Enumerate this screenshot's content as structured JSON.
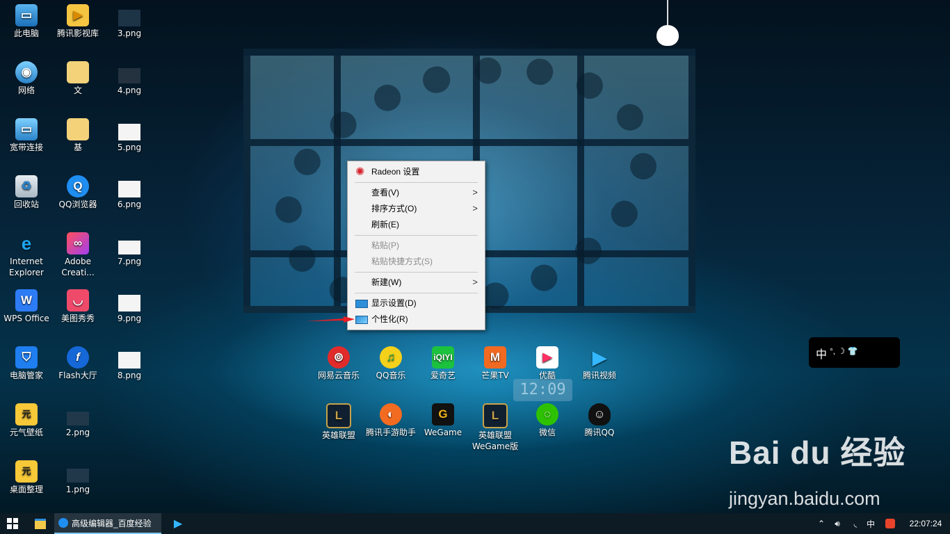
{
  "desktop_icons": [
    {
      "label": "此电脑",
      "icon": "computer-icon"
    },
    {
      "label": "腾讯影视库",
      "icon": "tencent-video-library-icon"
    },
    {
      "label": "3.png",
      "icon": "png-file-icon"
    },
    {
      "label": "网络",
      "icon": "network-icon"
    },
    {
      "label": "文",
      "icon": "folder-icon"
    },
    {
      "label": "4.png",
      "icon": "png-file-icon"
    },
    {
      "label": "宽带连接",
      "icon": "broadband-icon"
    },
    {
      "label": "基",
      "icon": "folder-icon"
    },
    {
      "label": "5.png",
      "icon": "png-file-icon"
    },
    {
      "label": "回收站",
      "icon": "recycle-bin-icon"
    },
    {
      "label": "QQ浏览器",
      "icon": "qq-browser-icon"
    },
    {
      "label": "6.png",
      "icon": "png-file-icon"
    },
    {
      "label": "Internet Explorer",
      "icon": "ie-icon"
    },
    {
      "label": "Adobe Creati...",
      "icon": "adobe-cc-icon"
    },
    {
      "label": "7.png",
      "icon": "png-file-icon"
    },
    {
      "label": "WPS Office",
      "icon": "wps-icon"
    },
    {
      "label": "美图秀秀",
      "icon": "meitu-icon"
    },
    {
      "label": "9.png",
      "icon": "png-file-icon"
    },
    {
      "label": "电脑管家",
      "icon": "pc-manager-icon"
    },
    {
      "label": "Flash大厅",
      "icon": "flash-icon"
    },
    {
      "label": "8.png",
      "icon": "png-file-icon"
    },
    {
      "label": "元气壁纸",
      "icon": "yuanqi-wallpaper-icon"
    },
    {
      "label": "2.png",
      "icon": "png-file-icon"
    },
    {
      "label": "桌面整理",
      "icon": "desktop-organizer-icon"
    },
    {
      "label": "1.png",
      "icon": "png-file-icon"
    },
    {
      "label": "网易云音乐",
      "icon": "netease-music-icon"
    },
    {
      "label": "QQ音乐",
      "icon": "qq-music-icon"
    },
    {
      "label": "爱奇艺",
      "icon": "iqiyi-icon"
    },
    {
      "label": "芒果TV",
      "icon": "mango-tv-icon"
    },
    {
      "label": "优酷",
      "icon": "youku-icon"
    },
    {
      "label": "腾讯视频",
      "icon": "tencent-video-icon"
    },
    {
      "label": "英雄联盟",
      "icon": "lol-icon"
    },
    {
      "label": "腾讯手游助手",
      "icon": "tencent-mobile-game-icon"
    },
    {
      "label": "WeGame",
      "icon": "wegame-icon"
    },
    {
      "label": "英雄联盟WeGame版",
      "icon": "lol-wegame-icon"
    },
    {
      "label": "微信",
      "icon": "wechat-icon"
    },
    {
      "label": "腾讯QQ",
      "icon": "qq-icon"
    }
  ],
  "context_menu": {
    "items": [
      {
        "label": "Radeon 设置",
        "icon": "radeon-icon"
      },
      {
        "label": "查看(V)",
        "submenu": true
      },
      {
        "label": "排序方式(O)",
        "submenu": true
      },
      {
        "label": "刷新(E)"
      },
      {
        "label": "粘贴(P)",
        "disabled": true
      },
      {
        "label": "粘贴快捷方式(S)",
        "disabled": true
      },
      {
        "label": "新建(W)",
        "submenu": true
      },
      {
        "label": "显示设置(D)",
        "icon": "display-icon"
      },
      {
        "label": "个性化(R)",
        "icon": "personalize-icon"
      }
    ]
  },
  "clock_widget": {
    "time": "12:09"
  },
  "tray_widget": {
    "ime": "中",
    "symbols": "°, ☽ 👕"
  },
  "taskbar": {
    "active_window": "高级编辑器_百度经验",
    "tray_ime": "中",
    "time": "22:07:24"
  },
  "watermark": {
    "logo": "Bai du 经验",
    "url": "jingyan.baidu.com"
  },
  "colors": {
    "taskbar_bg": "#0d1b24",
    "menu_bg": "#f2f2f2",
    "highlight": "#e81e25"
  }
}
